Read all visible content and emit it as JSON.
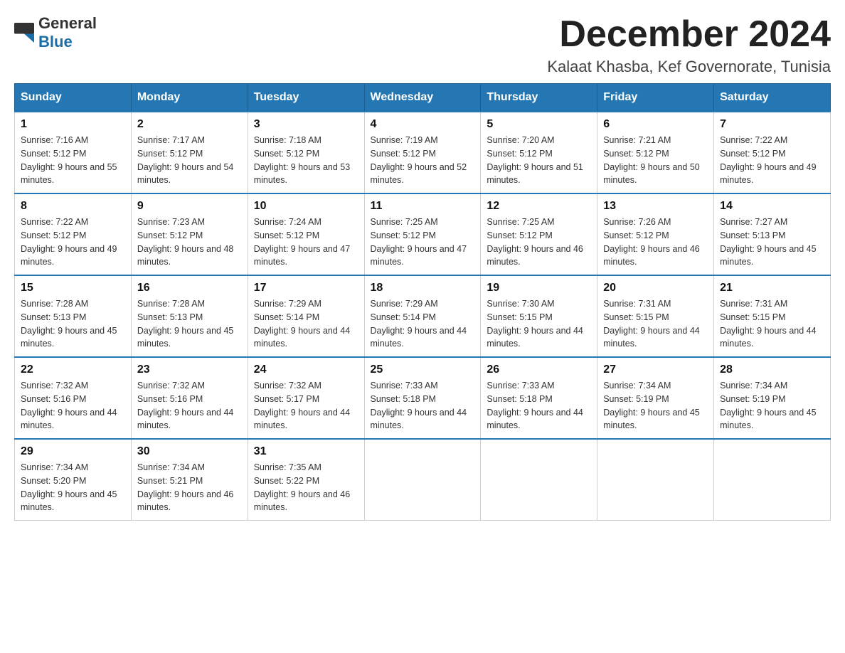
{
  "logo": {
    "general": "General",
    "blue": "Blue"
  },
  "title": "December 2024",
  "location": "Kalaat Khasba, Kef Governorate, Tunisia",
  "days_of_week": [
    "Sunday",
    "Monday",
    "Tuesday",
    "Wednesday",
    "Thursday",
    "Friday",
    "Saturday"
  ],
  "weeks": [
    [
      {
        "day": "1",
        "sunrise": "7:16 AM",
        "sunset": "5:12 PM",
        "daylight": "9 hours and 55 minutes."
      },
      {
        "day": "2",
        "sunrise": "7:17 AM",
        "sunset": "5:12 PM",
        "daylight": "9 hours and 54 minutes."
      },
      {
        "day": "3",
        "sunrise": "7:18 AM",
        "sunset": "5:12 PM",
        "daylight": "9 hours and 53 minutes."
      },
      {
        "day": "4",
        "sunrise": "7:19 AM",
        "sunset": "5:12 PM",
        "daylight": "9 hours and 52 minutes."
      },
      {
        "day": "5",
        "sunrise": "7:20 AM",
        "sunset": "5:12 PM",
        "daylight": "9 hours and 51 minutes."
      },
      {
        "day": "6",
        "sunrise": "7:21 AM",
        "sunset": "5:12 PM",
        "daylight": "9 hours and 50 minutes."
      },
      {
        "day": "7",
        "sunrise": "7:22 AM",
        "sunset": "5:12 PM",
        "daylight": "9 hours and 49 minutes."
      }
    ],
    [
      {
        "day": "8",
        "sunrise": "7:22 AM",
        "sunset": "5:12 PM",
        "daylight": "9 hours and 49 minutes."
      },
      {
        "day": "9",
        "sunrise": "7:23 AM",
        "sunset": "5:12 PM",
        "daylight": "9 hours and 48 minutes."
      },
      {
        "day": "10",
        "sunrise": "7:24 AM",
        "sunset": "5:12 PM",
        "daylight": "9 hours and 47 minutes."
      },
      {
        "day": "11",
        "sunrise": "7:25 AM",
        "sunset": "5:12 PM",
        "daylight": "9 hours and 47 minutes."
      },
      {
        "day": "12",
        "sunrise": "7:25 AM",
        "sunset": "5:12 PM",
        "daylight": "9 hours and 46 minutes."
      },
      {
        "day": "13",
        "sunrise": "7:26 AM",
        "sunset": "5:12 PM",
        "daylight": "9 hours and 46 minutes."
      },
      {
        "day": "14",
        "sunrise": "7:27 AM",
        "sunset": "5:13 PM",
        "daylight": "9 hours and 45 minutes."
      }
    ],
    [
      {
        "day": "15",
        "sunrise": "7:28 AM",
        "sunset": "5:13 PM",
        "daylight": "9 hours and 45 minutes."
      },
      {
        "day": "16",
        "sunrise": "7:28 AM",
        "sunset": "5:13 PM",
        "daylight": "9 hours and 45 minutes."
      },
      {
        "day": "17",
        "sunrise": "7:29 AM",
        "sunset": "5:14 PM",
        "daylight": "9 hours and 44 minutes."
      },
      {
        "day": "18",
        "sunrise": "7:29 AM",
        "sunset": "5:14 PM",
        "daylight": "9 hours and 44 minutes."
      },
      {
        "day": "19",
        "sunrise": "7:30 AM",
        "sunset": "5:15 PM",
        "daylight": "9 hours and 44 minutes."
      },
      {
        "day": "20",
        "sunrise": "7:31 AM",
        "sunset": "5:15 PM",
        "daylight": "9 hours and 44 minutes."
      },
      {
        "day": "21",
        "sunrise": "7:31 AM",
        "sunset": "5:15 PM",
        "daylight": "9 hours and 44 minutes."
      }
    ],
    [
      {
        "day": "22",
        "sunrise": "7:32 AM",
        "sunset": "5:16 PM",
        "daylight": "9 hours and 44 minutes."
      },
      {
        "day": "23",
        "sunrise": "7:32 AM",
        "sunset": "5:16 PM",
        "daylight": "9 hours and 44 minutes."
      },
      {
        "day": "24",
        "sunrise": "7:32 AM",
        "sunset": "5:17 PM",
        "daylight": "9 hours and 44 minutes."
      },
      {
        "day": "25",
        "sunrise": "7:33 AM",
        "sunset": "5:18 PM",
        "daylight": "9 hours and 44 minutes."
      },
      {
        "day": "26",
        "sunrise": "7:33 AM",
        "sunset": "5:18 PM",
        "daylight": "9 hours and 44 minutes."
      },
      {
        "day": "27",
        "sunrise": "7:34 AM",
        "sunset": "5:19 PM",
        "daylight": "9 hours and 45 minutes."
      },
      {
        "day": "28",
        "sunrise": "7:34 AM",
        "sunset": "5:19 PM",
        "daylight": "9 hours and 45 minutes."
      }
    ],
    [
      {
        "day": "29",
        "sunrise": "7:34 AM",
        "sunset": "5:20 PM",
        "daylight": "9 hours and 45 minutes."
      },
      {
        "day": "30",
        "sunrise": "7:34 AM",
        "sunset": "5:21 PM",
        "daylight": "9 hours and 46 minutes."
      },
      {
        "day": "31",
        "sunrise": "7:35 AM",
        "sunset": "5:22 PM",
        "daylight": "9 hours and 46 minutes."
      },
      null,
      null,
      null,
      null
    ]
  ]
}
